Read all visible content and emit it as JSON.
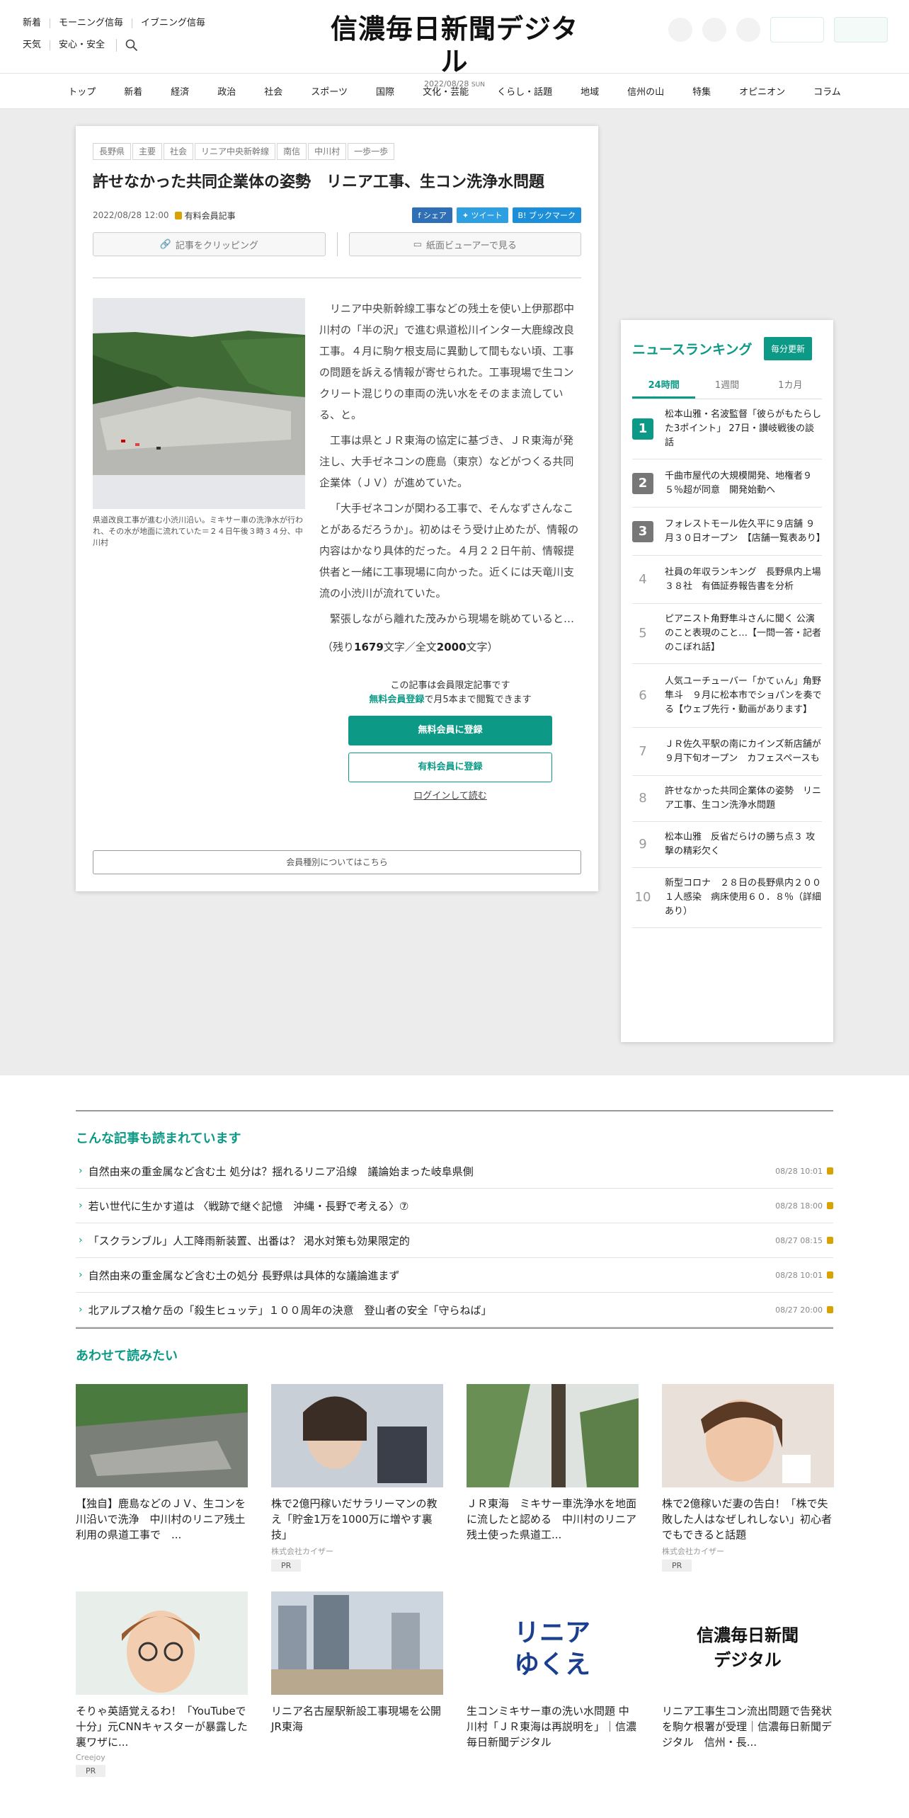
{
  "header": {
    "top_links": [
      "新着",
      "モーニング信毎",
      "イブニング信毎"
    ],
    "sub_links": [
      "天気",
      "安心・安全"
    ],
    "logo": "信濃毎日新聞デジタル",
    "date": "2022/08/28",
    "day": "SUN"
  },
  "nav": [
    "トップ",
    "新着",
    "経済",
    "政治",
    "社会",
    "スポーツ",
    "国際",
    "文化・芸能",
    "くらし・話題",
    "地域",
    "信州の山",
    "特集",
    "オピニオン",
    "コラム"
  ],
  "article": {
    "tags": [
      "長野県",
      "主要",
      "社会",
      "リニア中央新幹線",
      "南信",
      "中川村",
      "一歩一歩"
    ],
    "headline": "許せなかった共同企業体の姿勢　リニア工事、生コン洗浄水問題",
    "datetime": "2022/08/28 12:00",
    "members_label": "有料会員記事",
    "share": [
      "シェア",
      "ツイート",
      "ブックマーク"
    ],
    "clip_label": "記事をクリッピング",
    "viewer_label": "紙面ビューアーで見る",
    "caption": "県道改良工事が進む小渋川沿い。ミキサー車の洗浄水が行われ、その水が地面に流れていた＝２４日午後３時３４分、中川村",
    "paragraphs": [
      "リニア中央新幹線工事などの残土を使い上伊那郡中川村の「半の沢」で進む県道松川インター大鹿線改良工事。４月に駒ケ根支局に異動して間もない頃、工事の問題を訴える情報が寄せられた。工事現場で生コンクリート混じりの車両の洗い水をそのまま流している、と。",
      "工事は県とＪＲ東海の協定に基づき、ＪＲ東海が発注し、大手ゼネコンの鹿島（東京）などがつくる共同企業体（ＪＶ）が進めていた。",
      "「大手ゼネコンが関わる工事で、そんなずさんなことがあるだろうか」。初めはそう受け止めたが、情報の内容はかなり具体的だった。４月２２日午前、情報提供者と一緒に工事現場に向かった。近くには天竜川支流の小渋川が流れていた。",
      "緊張しながら離れた茂みから現場を眺めていると…"
    ],
    "remain_prefix": "（残り",
    "remain_chars": "1679",
    "remain_mid": "文字／全文",
    "total_chars": "2000",
    "remain_suffix": "文字）",
    "paywall_line1": "この記事は会員限定記事です",
    "paywall_link": "無料会員登録",
    "paywall_line2": "で月5本まで閲覧できます",
    "free_btn": "無料会員に登録",
    "paid_btn": "有料会員に登録",
    "login": "ログインして読む",
    "member_types": "会員種別についてはこちら"
  },
  "ranking": {
    "title": "ニュースランキング",
    "badge": "毎分更新",
    "tabs": [
      "24時間",
      "1週間",
      "1カ月"
    ],
    "items": [
      {
        "n": "1",
        "t": "松本山雅・名波監督「彼らがもたらした3ポイント」 27日・讃岐戦後の談話"
      },
      {
        "n": "2",
        "t": "千曲市屋代の大規模開発、地権者９５％超が同意　開発始動へ"
      },
      {
        "n": "3",
        "t": "フォレストモール佐久平に９店舗 ９月３０日オープン　【店舗一覧表あり】"
      },
      {
        "n": "4",
        "t": "社員の年収ランキング　長野県内上場３８社　有価証券報告書を分析"
      },
      {
        "n": "5",
        "t": "ピアニスト角野隼斗さんに聞く 公演のこと表現のこと…【一問一答・記者のこぼれ話】"
      },
      {
        "n": "6",
        "t": "人気ユーチューバー「かてぃん」角野隼斗　９月に松本市でショパンを奏でる【ウェブ先行・動画があります】"
      },
      {
        "n": "7",
        "t": "ＪＲ佐久平駅の南にカインズ新店舗が９月下旬オープン　カフェスペースも"
      },
      {
        "n": "8",
        "t": "許せなかった共同企業体の姿勢　リニア工事、生コン洗浄水問題"
      },
      {
        "n": "9",
        "t": "松本山雅　反省だらけの勝ち点３ 攻撃の精彩欠く"
      },
      {
        "n": "10",
        "t": "新型コロナ　２８日の長野県内２００１人感染　病床使用６０．８％（詳細あり）"
      }
    ]
  },
  "related": {
    "title": "こんな記事も読まれています",
    "items": [
      {
        "t": "自然由来の重金属など含む土 処分は？揺れるリニア沿線　議論始まった岐阜県側",
        "d": "08/28 10:01"
      },
      {
        "t": "若い世代に生かす道は 〈戦跡で継ぐ記憶　沖縄・長野で考える〉⑦",
        "d": "08/28 18:00"
      },
      {
        "t": "「スクランブル」人工降雨新装置、出番は？ 渇水対策も効果限定的",
        "d": "08/27 08:15"
      },
      {
        "t": "自然由来の重金属など含む土の処分 長野県は具体的な議論進まず",
        "d": "08/28 10:01"
      },
      {
        "t": "北アルプス槍ケ岳の「殺生ヒュッテ」１００周年の決意　登山者の安全「守らねば」",
        "d": "08/27 20:00"
      }
    ]
  },
  "recommend": {
    "title": "あわせて読みたい",
    "cards": [
      {
        "t": "【独自】鹿島などのＪＶ、生コンを川沿いで洗浄　中川村のリニア残土利用の県道工事で　...",
        "src": "",
        "pr": ""
      },
      {
        "t": "株で2億円稼いだサラリーマンの教え「貯金1万を1000万に増やす裏技」",
        "src": "株式会社カイザー",
        "pr": "PR"
      },
      {
        "t": "ＪＲ東海　ミキサー車洗浄水を地面に流したと認める　中川村のリニア残土使った県道工...",
        "src": "",
        "pr": ""
      },
      {
        "t": "株で2億稼いだ妻の告白！「株で失敗した人はなぜしれしない」初心者でもできると話題",
        "src": "株式会社カイザー",
        "pr": "PR"
      },
      {
        "t": "そりゃ英語覚えるわ！「YouTubeで十分」元CNNキャスターが暴露した裏ワザに...",
        "src": "Creejoy",
        "pr": "PR"
      },
      {
        "t": "リニア名古屋駅新設工事現場を公開　JR東海",
        "src": "",
        "pr": ""
      },
      {
        "t": "生コンミキサー車の洗い水問題 中川村「ＪＲ東海は再説明を」｜信濃毎日新聞デジタル",
        "src": "",
        "pr": ""
      },
      {
        "t": "リニア工事生コン流出問題で告発状を駒ケ根署が受理｜信濃毎日新聞デジタル　信州・長...",
        "src": "",
        "pr": ""
      }
    ],
    "linear_logo": "リニアのゆくえ"
  }
}
